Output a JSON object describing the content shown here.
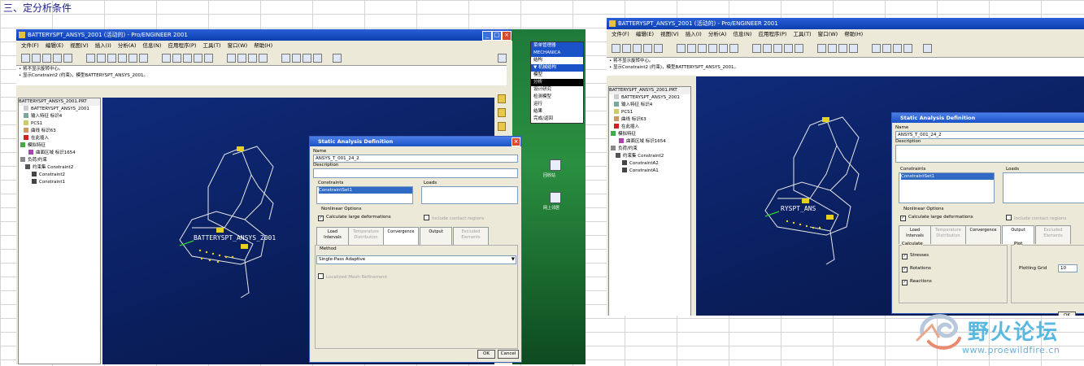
{
  "sheet": {
    "title": "三、定分析条件"
  },
  "left": {
    "window_title": "BATTERYSPT_ANSYS_2001 (活动的) - Pro/ENGINEER 2001",
    "menus": [
      "文件(F)",
      "编辑(E)",
      "视图(V)",
      "插入(I)",
      "分析(A)",
      "信息(N)",
      "应用程序(P)",
      "工具(T)",
      "窗口(W)",
      "帮助(H)"
    ],
    "messages": [
      "• 将不显示旋转中心。",
      "• 显示Constraint2 (约束)，模型BATTERYSPT_ANSYS_2001。"
    ],
    "tree": [
      "BATTERYSPT_ANSYS_2001.PRT",
      "BATTERYSPT_ANSYS_2001",
      "输入特征 标识4",
      "PCS1",
      "曲线 标识63",
      "在此插入",
      "模拟特征",
      "曲面区域 标识1654",
      "负荷/约束",
      "约束集 Constraint2",
      "Constraint2",
      "Constraint1"
    ],
    "model_label": "BATTERYSPT_ANSYS_2001",
    "dialog": {
      "title": "Static Analysis Definition",
      "name_label": "Name",
      "name_value": "ANSYS_T_001_24_2",
      "description_label": "Description",
      "constraints_label": "Constraints",
      "constraints_item": "ConstraintSet1",
      "loads_label": "Loads",
      "nonlinear_label": "Nonlinear Options",
      "large_deform": "Calculate large deformations",
      "contact": "Include contact regions",
      "tabs": [
        "Load Intervals",
        "Temperature Distribution",
        "Convergence",
        "Output",
        "Excluded Elements"
      ],
      "method_label": "Method",
      "method_value": "Single-Pass Adaptive",
      "localized": "Localized Mesh Refinement",
      "ok": "OK",
      "cancel": "Cancel"
    },
    "popup_menu": {
      "title": "菜单管理器",
      "items": [
        "MECHANICA",
        "结构",
        "▼ 机械结构",
        "模型",
        "分析",
        "设计研究",
        "检测模型",
        "运行",
        "结果",
        "完成/返回"
      ]
    },
    "desktop_labels": [
      "回收站",
      "中文打印",
      "网上邻居"
    ]
  },
  "right": {
    "window_title": "BATTERYSPT_ANSYS_2001 (活动的) - Pro/ENGINEER 2001",
    "menus": [
      "文件(F)",
      "编辑(E)",
      "视图(V)",
      "插入(I)",
      "分析(A)",
      "信息(N)",
      "应用程序(P)",
      "工具(T)",
      "窗口(W)",
      "帮助(H)"
    ],
    "messages": [
      "• 将不显示旋转中心。",
      "• 显示Constraint2 (约束)，模型BATTERYSPT_ANSYS_2001。"
    ],
    "tree": [
      "BATTERYSPT_ANSYS_2001.PRT",
      "BATTERYSPT_ANSYS_2001",
      "输入特征 标识4",
      "PCS1",
      "曲线 标识63",
      "在此插入",
      "模拟特征",
      "曲面区域 标识1654",
      "负荷/约束",
      "约束集 Constraint2",
      "ConstraintA2",
      "ConstraintA1"
    ],
    "model_label": "RYSPT_ANS",
    "dialog": {
      "title": "Static Analysis Definition",
      "name_label": "Name",
      "name_value": "ANSYS_T_001_24_2",
      "description_label": "Description",
      "constraints_label": "Constraints",
      "constraints_item": "ConstraintSet1",
      "loads_label": "Loads",
      "nonlinear_label": "Nonlinear Options",
      "large_deform": "Calculate large deformations",
      "contact": "Include contact regions",
      "tabs": [
        "Load Intervals",
        "Temperature Distribution",
        "Convergence",
        "Output",
        "Excluded Elements"
      ],
      "calculate_label": "Calculate",
      "plot_label": "Plot",
      "stresses": "Stresses",
      "rotations": "Rotations",
      "reactions": "Reactions",
      "plotting_grid": "Plotting Grid",
      "plotting_grid_value": "10",
      "ok": "OK"
    }
  },
  "watermark": {
    "text": "野火论坛",
    "url": "www.proewildfire.cn"
  }
}
